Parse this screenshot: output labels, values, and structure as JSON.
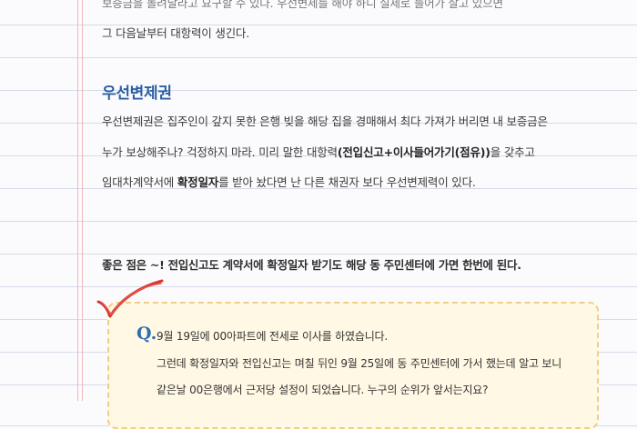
{
  "top_lines": [
    "보증금을 돌려달라고 요구할 수 있다. 우선변제를 해야 하니 실제로 들어가 살고 있으면",
    "그 다음날부터 대항력이 생긴다."
  ],
  "section_title": "우선변제권",
  "paragraph": {
    "line1": "우선변제권은 집주인이 갚지 못한 은행 빚을 해당 집을 경매해서 최다 가져가 버리면 내 보증금은",
    "line2_pre": "누가 보상해주나? 걱정하지 마라. 미리 말한 대항력",
    "line2_bold": "(전입신고+이사들어가기(점유))",
    "line2_post": "을 갖추고",
    "line3_pre": "임대차계약서에 ",
    "line3_bold": "확정일자",
    "line3_post": "를 받아 놨다면 난 다른 채권자 보다 우선변제력이 있다."
  },
  "note": "좋은 점은 ~! 전입신고도 계약서에 확정일자 받기도 해당 동 주민센터에 가면 한번에 된다.",
  "qa": {
    "marker": "Q.",
    "lines": [
      "9월 19일에 00아파트에 전세로 이사를 하였습니다.",
      "그런데 확정일자와 전입신고는 며칠 뒤인 9월 25일에 동 주민센터에 가서 했는데 알고 보니",
      "같은날 00은행에서 근저당 설정이 되었습니다. 누구의 순위가 앞서는지요?"
    ]
  },
  "colors": {
    "heading": "#2c5fa3",
    "check_mark": "#d9352f",
    "box_fill": "#fff8e4",
    "box_border": "#f0cf86"
  }
}
